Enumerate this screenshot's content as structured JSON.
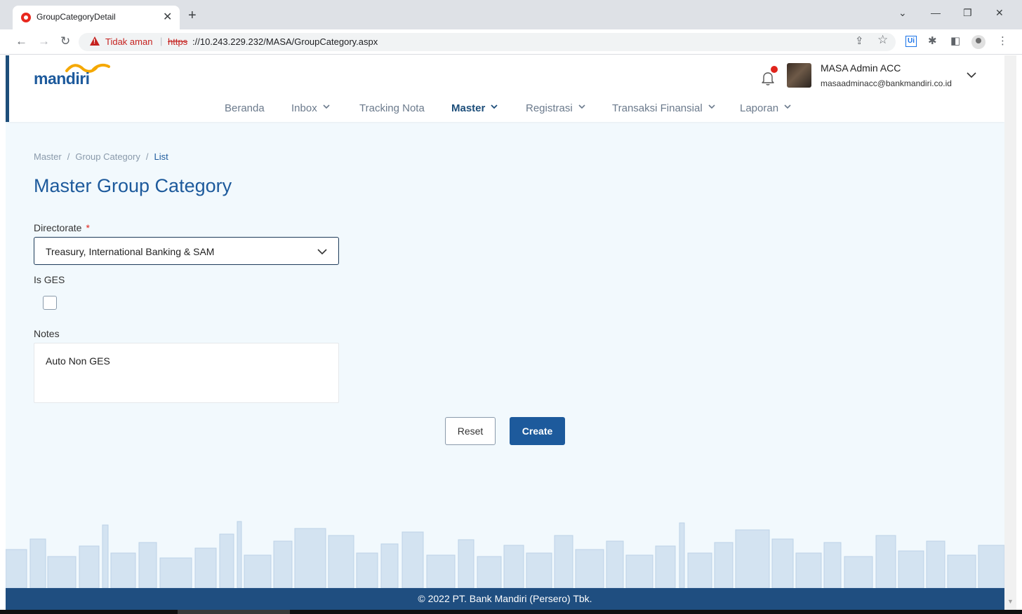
{
  "browser": {
    "tab_title": "GroupCategoryDetail",
    "tab_close": "✕",
    "new_tab": "+",
    "window_controls": [
      "⌄",
      "—",
      "❐",
      "✕"
    ],
    "nav": {
      "back": "←",
      "forward": "→",
      "reload": "↻"
    },
    "security_label": "Tidak aman",
    "url_separator": "|",
    "url_scheme": "https",
    "url_rest": "://10.243.229.232/MASA/GroupCategory.aspx",
    "toolbar_icons": [
      "share-icon",
      "star-icon",
      "ui-extension-icon",
      "puzzle-icon",
      "sidepanel-icon",
      "profile-icon",
      "more-icon"
    ],
    "ext_label": "Ui",
    "star": "☆",
    "share": "⇪",
    "puzzle": "✱",
    "sidepanel": "◧",
    "more": "⋮"
  },
  "header": {
    "logo_text": "mandiri",
    "user_name": "MASA Admin ACC",
    "user_email": "masaadminacc@bankmandiri.co.id",
    "notification_dot_color": "#e0241c"
  },
  "menu": [
    {
      "label": "Beranda",
      "dropdown": false
    },
    {
      "label": "Inbox",
      "dropdown": true
    },
    {
      "label": "Tracking Nota",
      "dropdown": false
    },
    {
      "label": "Master",
      "dropdown": true,
      "active": true
    },
    {
      "label": "Registrasi",
      "dropdown": true
    },
    {
      "label": "Transaksi Finansial",
      "dropdown": true
    },
    {
      "label": "Laporan",
      "dropdown": true
    }
  ],
  "breadcrumb": {
    "items": [
      "Master",
      "Group Category",
      "List"
    ],
    "separator": "/"
  },
  "page_title": "Master Group Category",
  "form": {
    "directorate_label": "Directorate",
    "required_mark": "*",
    "directorate_value": "Treasury, International Banking & SAM",
    "is_ges_label": "Is GES",
    "is_ges_checked": false,
    "notes_label": "Notes",
    "notes_value": "Auto Non GES"
  },
  "actions": {
    "reset_label": "Reset",
    "create_label": "Create"
  },
  "footer": {
    "text": "© 2022 PT. Bank Mandiri (Persero) Tbk."
  },
  "colors": {
    "brand_blue": "#1d5a9c",
    "footer_blue": "#1f4e80",
    "page_bg": "#f2f9fd",
    "skyline": "#c9dced"
  }
}
